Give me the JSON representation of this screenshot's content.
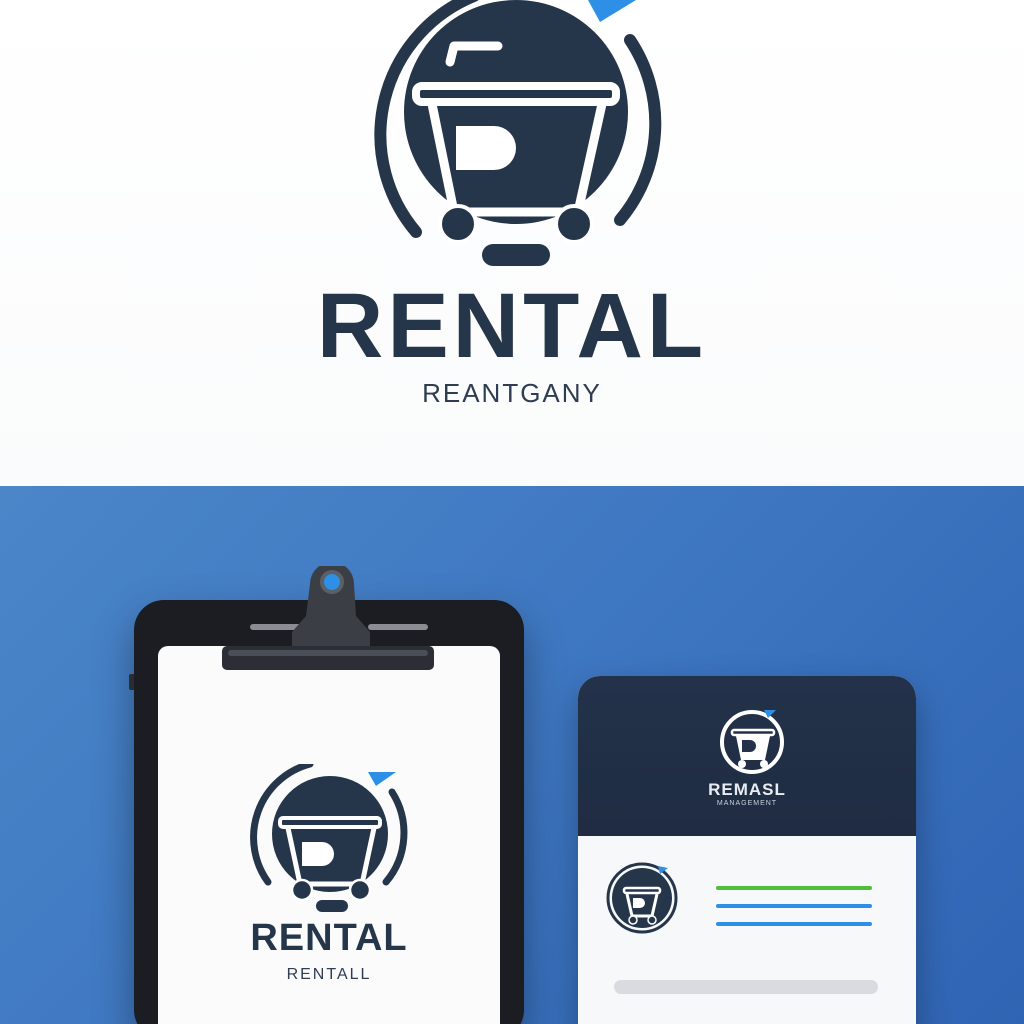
{
  "top": {
    "title": "RENTAL",
    "subtitle": "REANTGANY"
  },
  "tablet": {
    "title": "RENTAL",
    "subtitle": "RENTALL"
  },
  "card": {
    "title": "REMASL",
    "subtitle": "MANAGEMENT"
  },
  "icons": {
    "logo": "shopping-cart-icon",
    "clipboard_clip": "clip-icon"
  },
  "colors": {
    "brand_dark": "#26364a",
    "accent_blue": "#2e8fe6",
    "accent_green": "#4fbf3a",
    "background_blue": "#3f78c2"
  }
}
